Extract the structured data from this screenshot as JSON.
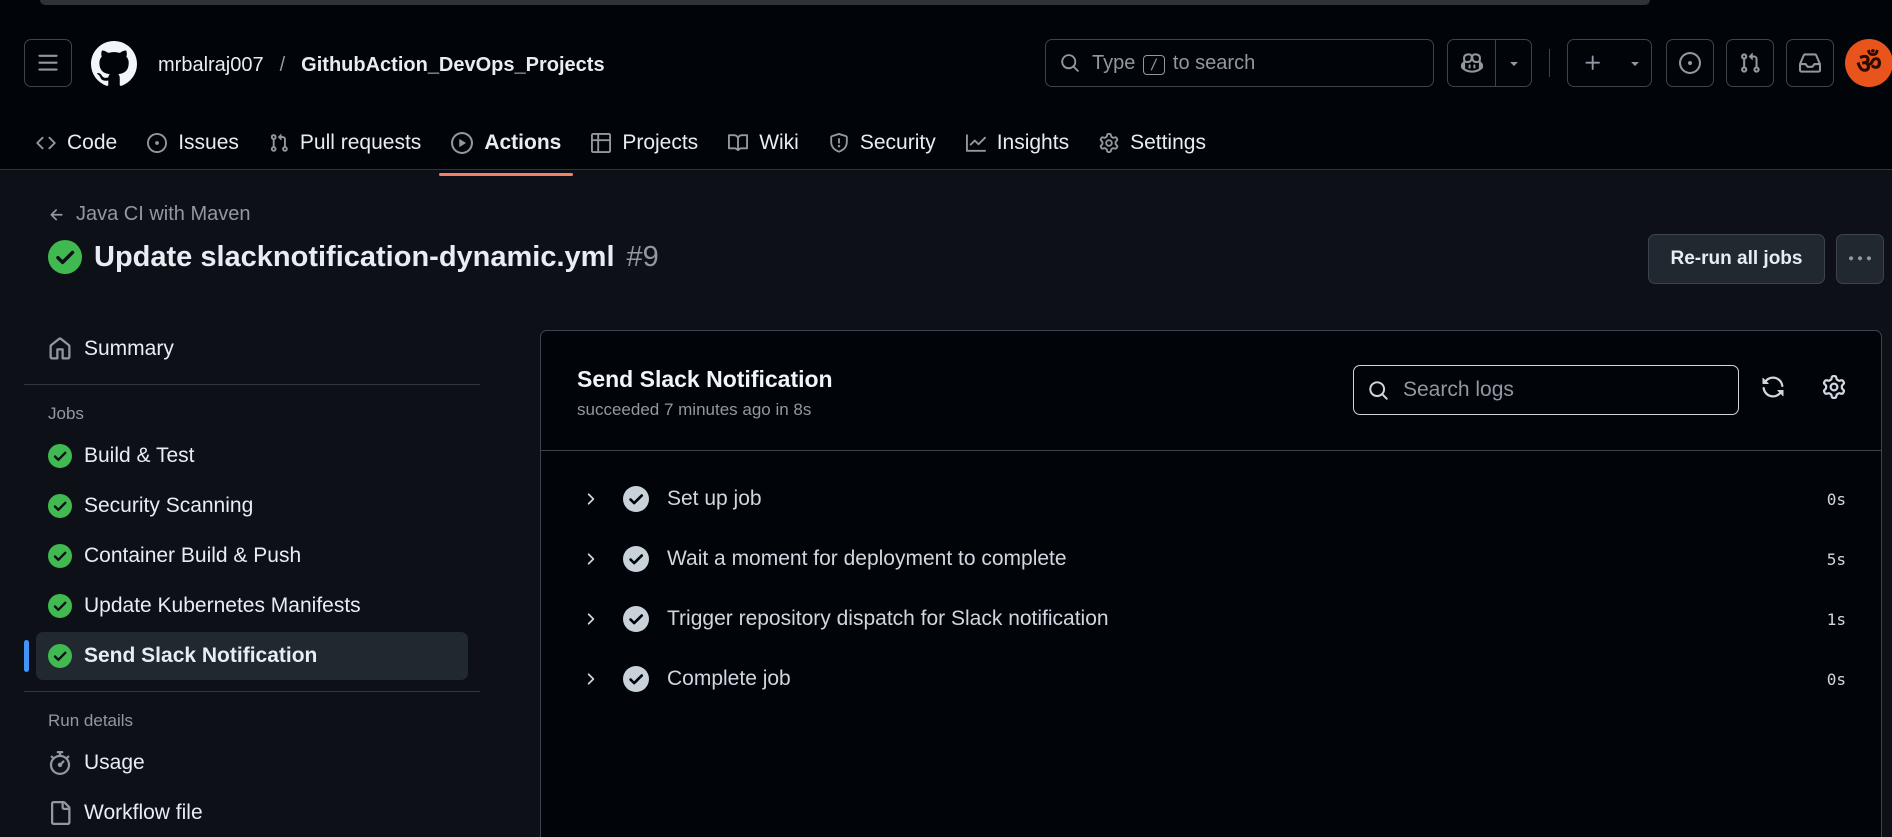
{
  "header": {
    "owner": "mrbalraj007",
    "separator": "/",
    "repo": "GithubAction_DevOps_Projects",
    "search": {
      "prefix": "Type",
      "key": "/",
      "suffix": "to search"
    }
  },
  "nav": {
    "tabs": [
      {
        "label": "Code",
        "icon": "code-icon"
      },
      {
        "label": "Issues",
        "icon": "issue-icon"
      },
      {
        "label": "Pull requests",
        "icon": "pull-request-icon"
      },
      {
        "label": "Actions",
        "icon": "play-icon",
        "active": true
      },
      {
        "label": "Projects",
        "icon": "table-icon"
      },
      {
        "label": "Wiki",
        "icon": "book-icon"
      },
      {
        "label": "Security",
        "icon": "shield-icon"
      },
      {
        "label": "Insights",
        "icon": "graph-icon"
      },
      {
        "label": "Settings",
        "icon": "gear-icon"
      }
    ]
  },
  "run": {
    "workflow": "Java CI with Maven",
    "title": "Update slacknotification-dynamic.yml",
    "number": "#9",
    "rerun_label": "Re-run all jobs"
  },
  "sidebar": {
    "summary": "Summary",
    "jobs_heading": "Jobs",
    "jobs": [
      {
        "label": "Build & Test",
        "status": "success"
      },
      {
        "label": "Security Scanning",
        "status": "success"
      },
      {
        "label": "Container Build & Push",
        "status": "success"
      },
      {
        "label": "Update Kubernetes Manifests",
        "status": "success"
      },
      {
        "label": "Send Slack Notification",
        "status": "success",
        "selected": true
      }
    ],
    "run_details_heading": "Run details",
    "usage": "Usage",
    "workflow_file": "Workflow file"
  },
  "log": {
    "job_name": "Send Slack Notification",
    "status_line": "succeeded 7 minutes ago in 8s",
    "search_placeholder": "Search logs",
    "steps": [
      {
        "name": "Set up job",
        "duration": "0s"
      },
      {
        "name": "Wait a moment for deployment to complete",
        "duration": "5s"
      },
      {
        "name": "Trigger repository dispatch for Slack notification",
        "duration": "1s"
      },
      {
        "name": "Complete job",
        "duration": "0s"
      }
    ]
  },
  "colors": {
    "success": "#3fb950",
    "accent_underline": "#f78166",
    "selection_bar": "#4493f8",
    "background": "#0d1117"
  }
}
